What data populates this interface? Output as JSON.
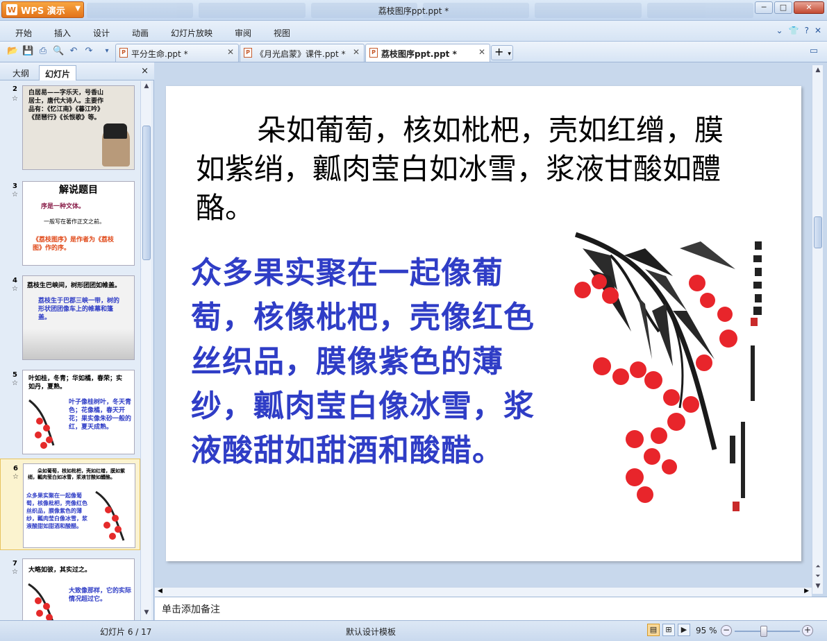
{
  "titlebar": {
    "app_button": "WPS 演示",
    "doc_title": "荔枝图序ppt.ppt *"
  },
  "menu": {
    "items": [
      "开始",
      "插入",
      "设计",
      "动画",
      "幻灯片放映",
      "审阅",
      "视图"
    ]
  },
  "tabs": [
    {
      "label": "平分生命.ppt *",
      "active": false
    },
    {
      "label": "《月光启蒙》课件.ppt *",
      "active": false
    },
    {
      "label": "荔枝图序ppt.ppt *",
      "active": true
    }
  ],
  "left_panel": {
    "tab_outline": "大纲",
    "tab_slides": "幻灯片",
    "close": "×"
  },
  "thumbnails": [
    {
      "num": "2",
      "text_a": "白居易——字乐天，号香山居士，唐代大诗人。主要作品有：《忆江南》《暮江吟》《琵琶行》《长恨歌》等。"
    },
    {
      "num": "3",
      "title": "解说题目",
      "line1": "序是一种文体。",
      "line2": "一般写在著作正文之前。",
      "line3": "《荔枝图序》是作者为《荔枝图》作的序。"
    },
    {
      "num": "4",
      "line1": "荔枝生巴峡间，树形团团如帷盖。",
      "line2": "荔枝生于巴郡三峡一带，树的形状团团像车上的帷幕和篷盖。"
    },
    {
      "num": "5",
      "line1": "叶如桂，冬青；华如橘，春荣；实如丹，夏熟。",
      "line2": "叶子像桂树叶，冬天青色；花像橘，春天开花；果实像朱砂一般的红，夏天成熟。"
    },
    {
      "num": "6",
      "line1": "朵如葡萄，核如枇杷，壳如红缯，膜如紫绡，瓤肉莹白如冰雪，浆液甘酸如醴酪。",
      "line2": "众多果实聚在一起像葡萄，核像枇杷，壳像红色丝织品，膜像紫色的薄纱，瓤肉莹白像冰雪，浆液酸甜如甜酒和酸醋。"
    },
    {
      "num": "7",
      "line1": "大略如彼，其实过之。",
      "line2": "大致像那样，它的实际情况超过它。"
    }
  ],
  "slide": {
    "text_black": "朵如葡萄，核如枇杷，壳如红缯，膜如紫绡，瓤肉莹白如冰雪，浆液甘酸如醴酪。",
    "text_blue": "众多果实聚在一起像葡萄，核像枇杷，壳像红色丝织品，膜像紫色的薄纱，瓤肉莹白像冰雪，浆液酸甜如甜酒和酸醋。"
  },
  "notes_placeholder": "单击添加备注",
  "status": {
    "slide_counter": "幻灯片 6 / 17",
    "template": "默认设计模板",
    "zoom": "95 %"
  },
  "colors": {
    "blue_text": "#2f3dc6",
    "accent_orange": "#e2731a"
  }
}
